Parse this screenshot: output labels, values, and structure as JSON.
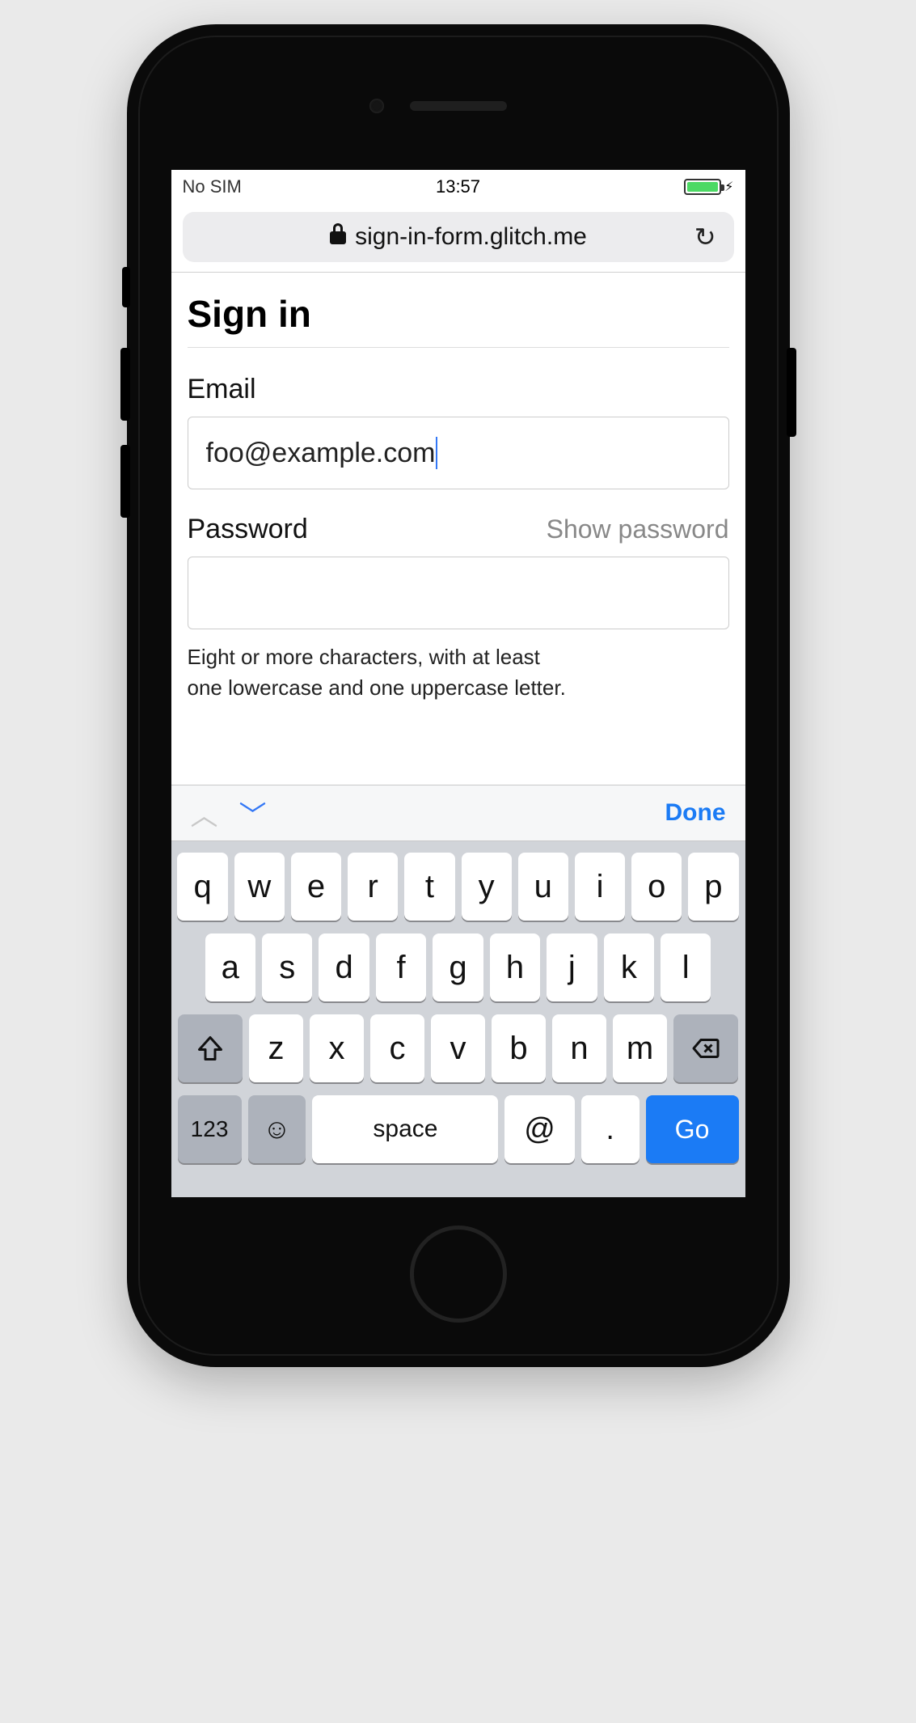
{
  "status": {
    "carrier": "No SIM",
    "time": "13:57"
  },
  "urlbar": {
    "host": "sign-in-form.glitch.me"
  },
  "page": {
    "title": "Sign in",
    "email_label": "Email",
    "email_value": "foo@example.com",
    "password_label": "Password",
    "show_password": "Show password",
    "password_value": "",
    "hint_line1": "Eight or more characters, with at least",
    "hint_line2": "one lowercase and one uppercase letter."
  },
  "kb_accessory": {
    "done": "Done"
  },
  "keyboard": {
    "row1": [
      "q",
      "w",
      "e",
      "r",
      "t",
      "y",
      "u",
      "i",
      "o",
      "p"
    ],
    "row2": [
      "a",
      "s",
      "d",
      "f",
      "g",
      "h",
      "j",
      "k",
      "l"
    ],
    "row3": [
      "z",
      "x",
      "c",
      "v",
      "b",
      "n",
      "m"
    ],
    "num_label": "123",
    "space_label": "space",
    "at_label": "@",
    "dot_label": ".",
    "go_label": "Go"
  }
}
